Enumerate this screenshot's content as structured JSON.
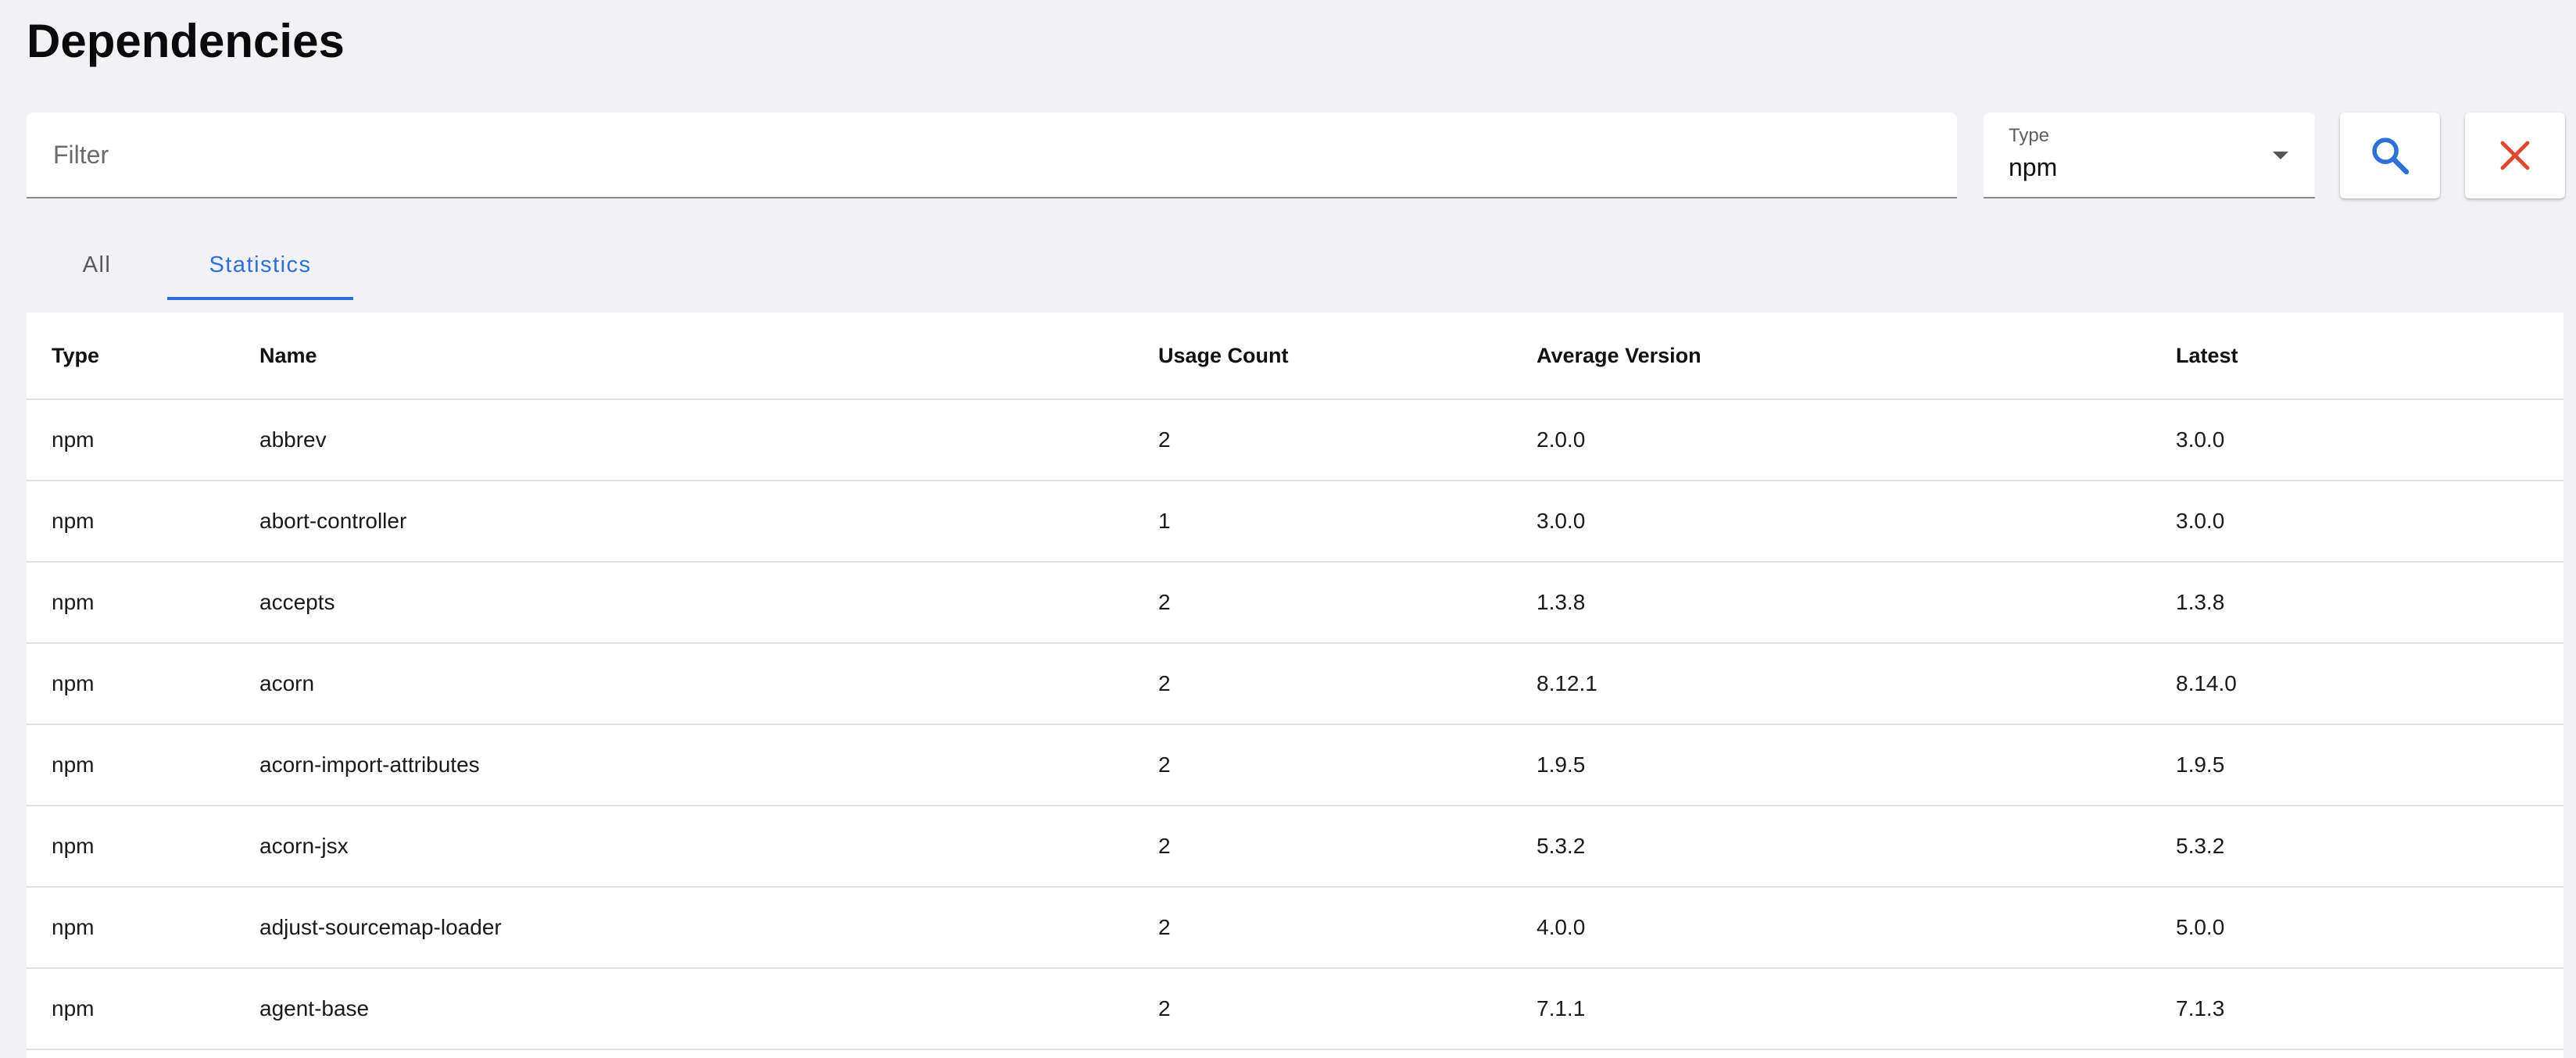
{
  "page": {
    "title": "Dependencies"
  },
  "filter": {
    "placeholder": "Filter",
    "value": ""
  },
  "type_select": {
    "label": "Type",
    "value": "npm"
  },
  "buttons": {
    "search_icon": "search-icon",
    "clear_icon": "close-icon"
  },
  "colors": {
    "accent": "#2f6fd8",
    "clear": "#e0492e",
    "background": "#f2f1f6"
  },
  "tabs": [
    {
      "label": "All",
      "active": false
    },
    {
      "label": "Statistics",
      "active": true
    }
  ],
  "table": {
    "headers": [
      "Type",
      "Name",
      "Usage Count",
      "Average Version",
      "Latest"
    ],
    "rows": [
      {
        "type": "npm",
        "name": "abbrev",
        "usage": "2",
        "avg": "2.0.0",
        "latest": "3.0.0"
      },
      {
        "type": "npm",
        "name": "abort-controller",
        "usage": "1",
        "avg": "3.0.0",
        "latest": "3.0.0"
      },
      {
        "type": "npm",
        "name": "accepts",
        "usage": "2",
        "avg": "1.3.8",
        "latest": "1.3.8"
      },
      {
        "type": "npm",
        "name": "acorn",
        "usage": "2",
        "avg": "8.12.1",
        "latest": "8.14.0"
      },
      {
        "type": "npm",
        "name": "acorn-import-attributes",
        "usage": "2",
        "avg": "1.9.5",
        "latest": "1.9.5"
      },
      {
        "type": "npm",
        "name": "acorn-jsx",
        "usage": "2",
        "avg": "5.3.2",
        "latest": "5.3.2"
      },
      {
        "type": "npm",
        "name": "adjust-sourcemap-loader",
        "usage": "2",
        "avg": "4.0.0",
        "latest": "5.0.0"
      },
      {
        "type": "npm",
        "name": "agent-base",
        "usage": "2",
        "avg": "7.1.1",
        "latest": "7.1.3"
      }
    ]
  }
}
